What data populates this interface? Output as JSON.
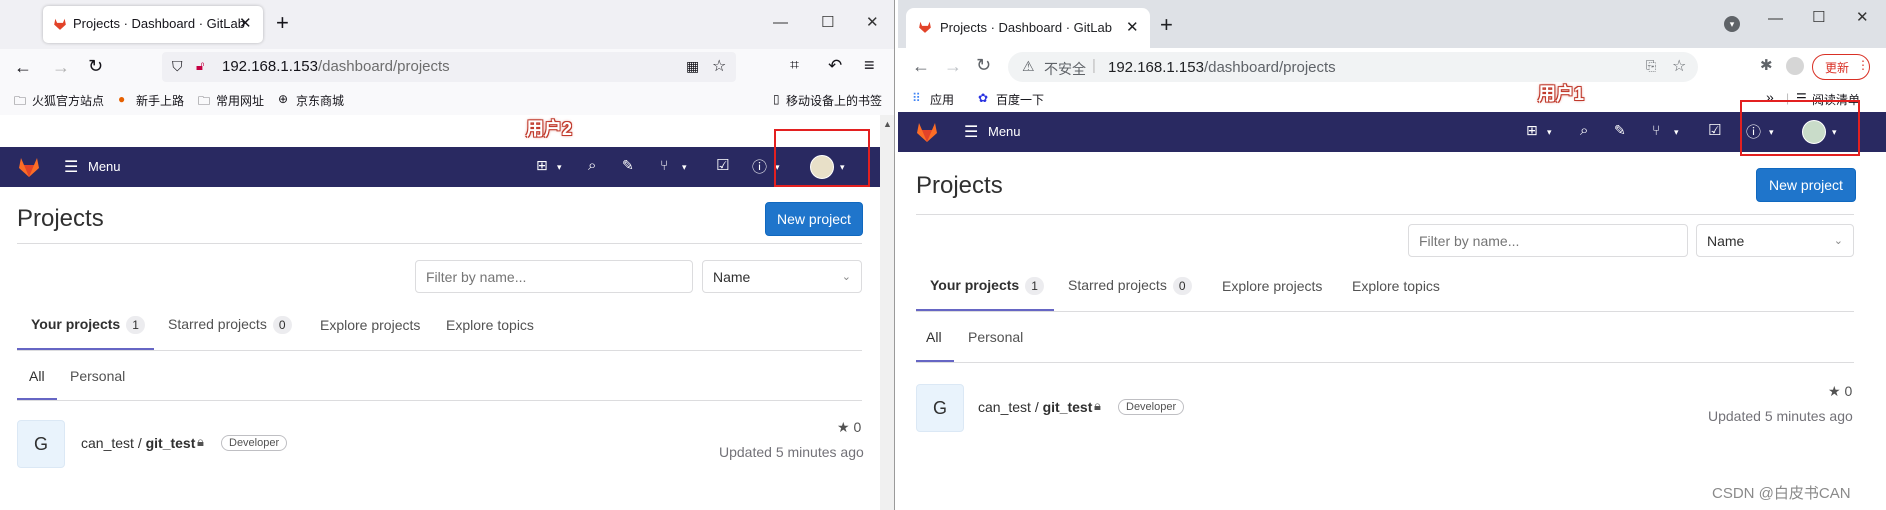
{
  "left": {
    "browser_tab_title": "Projects · Dashboard · GitLab",
    "url_host": "192.168.1.153",
    "url_path": "/dashboard/projects",
    "bookmarks": [
      "火狐官方站点",
      "新手上路",
      "常用网址",
      "京东商城"
    ],
    "mobile_bookmarks": "移动设备上的书签",
    "annotation": "用户2"
  },
  "right": {
    "browser_tab_title": "Projects · Dashboard · GitLab",
    "insecure_label": "不安全",
    "url_host": "192.168.1.153",
    "url_path": "/dashboard/projects",
    "bookmarks": [
      "应用",
      "百度一下"
    ],
    "reading_list": "阅读清单",
    "update_label": "更新",
    "annotation": "用户1",
    "watermark": "CSDN @白皮书CAN"
  },
  "gitlab": {
    "menu_label": "Menu",
    "page_title": "Projects",
    "new_project_label": "New project",
    "filter_placeholder": "Filter by name...",
    "sort_value": "Name",
    "tabs": [
      {
        "label": "Your projects",
        "count": "1"
      },
      {
        "label": "Starred projects",
        "count": "0"
      },
      {
        "label": "Explore projects"
      },
      {
        "label": "Explore topics"
      }
    ],
    "subtabs": [
      "All",
      "Personal"
    ],
    "project": {
      "avatar_letter": "G",
      "namespace": "can_test /",
      "name": "git_test",
      "role": "Developer",
      "stars": "0",
      "updated": "Updated 5 minutes ago"
    }
  },
  "colors": {
    "gitlab_header": "#292961",
    "primary_button": "#1f75cb",
    "active_tab_underline": "#6666c4",
    "annotation_box": "#e32020"
  }
}
